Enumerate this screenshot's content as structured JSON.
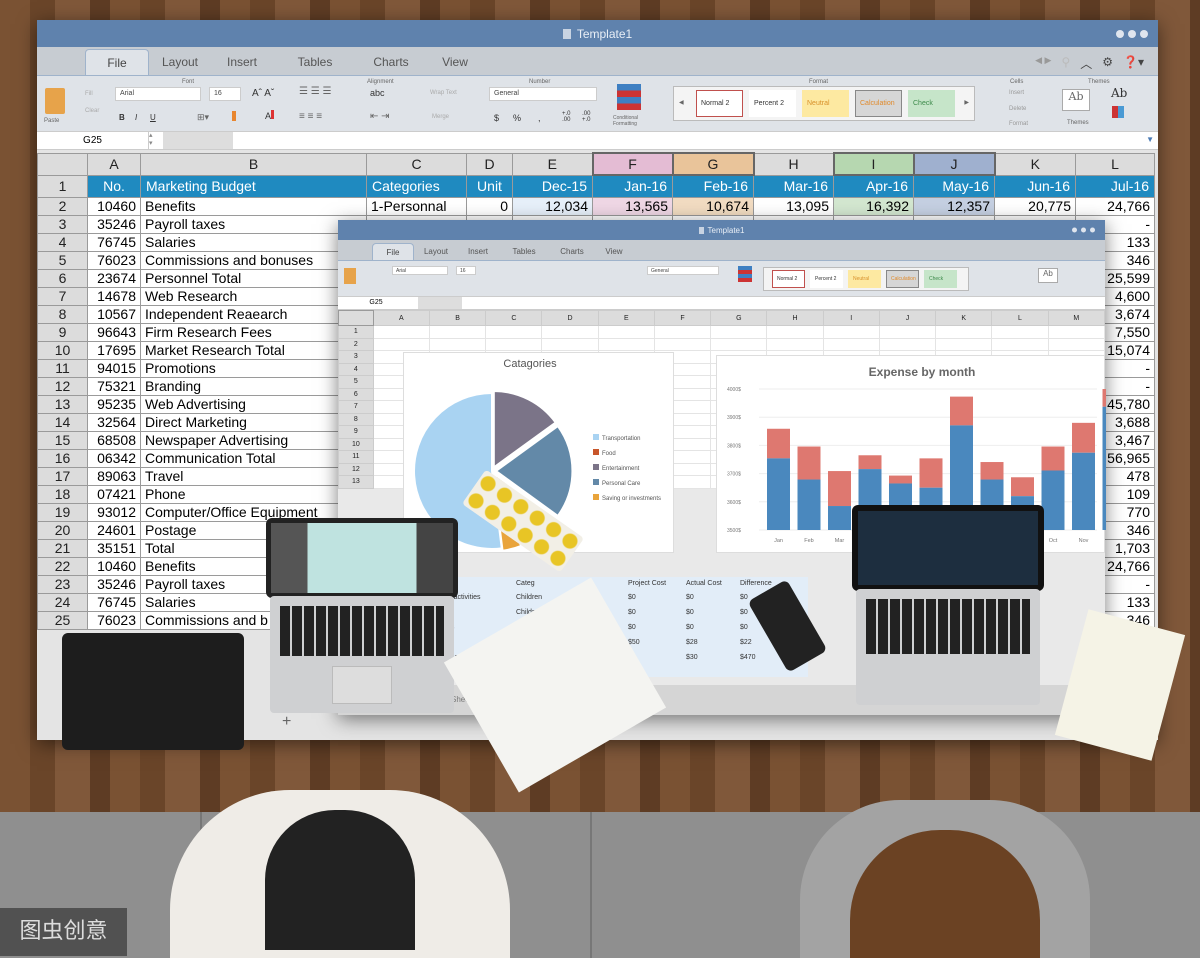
{
  "outer_window": {
    "title": "Template1",
    "tabs": [
      "File",
      "Layout",
      "Insert",
      "Tables",
      "Charts",
      "View"
    ],
    "active_tab": "File",
    "ribbon": {
      "paste": "Paste",
      "fill": "Fill",
      "clear": "Clear",
      "font_group": "Font",
      "font": "Arial",
      "size": "16",
      "bold": "B",
      "italic": "I",
      "underline": "U",
      "alignment_group": "Alignment",
      "abc": "abc",
      "wrap_text": "Wrap Text",
      "merge": "Merge",
      "number_group": "Number",
      "number_format": "General",
      "currency": "$",
      "percent": "%",
      "comma": ",",
      "inc_decimal": "+.0\n.00",
      "dec_decimal": ".00\n+.0",
      "conditional_formatting": "Conditional Formatting",
      "format_group": "Format",
      "styles": [
        {
          "label": "Normal 2",
          "bg": "#ffffff",
          "fg": "#333333",
          "border": "#c0504d"
        },
        {
          "label": "Percent 2",
          "bg": "#ffffff",
          "fg": "#333333",
          "border": "#ffffff"
        },
        {
          "label": "Neutral",
          "bg": "#fde9a1",
          "fg": "#d8902a",
          "border": "#fde9a1"
        },
        {
          "label": "Calculation",
          "bg": "#d6d6d6",
          "fg": "#e08a2c",
          "border": "#888888"
        },
        {
          "label": "Check",
          "bg": "#c6e5c9",
          "fg": "#3c8a4a",
          "border": "#c6e5c9"
        }
      ],
      "cells_group": "Cells",
      "insert": "Insert",
      "delete": "Delete",
      "format": "Format",
      "themes_group": "Themes",
      "themes": "Themes",
      "ab": "Ab"
    },
    "name_box": "G25",
    "columns": [
      "A",
      "B",
      "C",
      "D",
      "E",
      "F",
      "G",
      "H",
      "I",
      "J",
      "K",
      "L"
    ],
    "header_row": [
      "No.",
      "Marketing Budget",
      "Categories",
      "Unit",
      "Dec-15",
      "Jan-16",
      "Feb-16",
      "Mar-16",
      "Apr-16",
      "May-16",
      "Jun-16",
      "Jul-16"
    ],
    "highlight_columns": {
      "F": "#e4bcd4",
      "G": "#e9c49a",
      "I": "#b6d7b0",
      "J": "#9fb0cf"
    },
    "row2": [
      "10460",
      "Benefits",
      "1-Personnal",
      "0",
      "12,034",
      "13,565",
      "10,674",
      "13,095",
      "16,392",
      "12,357",
      "20,775",
      "24,766"
    ],
    "rows": [
      {
        "no": "35246",
        "name": "Payroll taxes",
        "jul": "-"
      },
      {
        "no": "76745",
        "name": "Salaries",
        "jul": "133"
      },
      {
        "no": "76023",
        "name": "Commissions and bonuses",
        "jul": "346"
      },
      {
        "no": "23674",
        "name": "Personnel Total",
        "jul": "25,599"
      },
      {
        "no": "14678",
        "name": "Web Research",
        "jul": "4,600"
      },
      {
        "no": "10567",
        "name": "Independent Reaearch",
        "jul": "3,674"
      },
      {
        "no": "96643",
        "name": "Firm Research Fees",
        "jul": "7,550"
      },
      {
        "no": "17695",
        "name": "Market Research Total",
        "jul": "15,074"
      },
      {
        "no": "94015",
        "name": "Promotions",
        "jul": "-"
      },
      {
        "no": "75321",
        "name": "Branding",
        "jul": "-"
      },
      {
        "no": "95235",
        "name": "Web Advertising",
        "jul": "45,780"
      },
      {
        "no": "32564",
        "name": "Direct Marketing",
        "jul": "3,688"
      },
      {
        "no": "68508",
        "name": "Newspaper Advertising",
        "jul": "3,467"
      },
      {
        "no": "06342",
        "name": "Communication Total",
        "jul": "56,965"
      },
      {
        "no": "89063",
        "name": "Travel",
        "jul": "478"
      },
      {
        "no": "07421",
        "name": "Phone",
        "jul": "109"
      },
      {
        "no": "93012",
        "name": "Computer/Office Equipment",
        "jul": "770"
      },
      {
        "no": "24601",
        "name": "Postage",
        "jul": "346"
      },
      {
        "no": "35151",
        "name": "Total",
        "jul": "1,703"
      },
      {
        "no": "10460",
        "name": "Benefits",
        "jul": "24,766"
      },
      {
        "no": "35246",
        "name": "Payroll taxes",
        "jul": "-"
      },
      {
        "no": "76745",
        "name": "Salaries",
        "jul": "133"
      },
      {
        "no": "76023",
        "name": "Commissions and b",
        "jul": "346"
      }
    ],
    "add_sheet": "+"
  },
  "inner_window": {
    "title": "Template1",
    "name_box": "G25",
    "columns": [
      "A",
      "B",
      "C",
      "D",
      "E",
      "F",
      "G",
      "H",
      "I",
      "J",
      "K",
      "L",
      "M"
    ],
    "sheet_tab": "Sheet",
    "table": {
      "headers": [
        "Categ",
        "Project Cost",
        "Actual Cost",
        "Difference"
      ],
      "rows": [
        [
          "ular activities",
          "Children",
          "$0",
          "$0",
          "$0"
        ],
        [
          "",
          "Childrer",
          "$0",
          "$0",
          "$0"
        ],
        [
          "plies",
          "Chil",
          "$0",
          "$0",
          "$0"
        ],
        [
          "",
          "",
          "$50",
          "$28",
          "$22"
        ],
        [
          "wnloads,etc.)",
          "",
          "",
          "$30",
          "$470"
        ]
      ]
    }
  },
  "chart_data": [
    {
      "type": "pie",
      "title": "Catagories",
      "legend": [
        "Transportation",
        "Food",
        "Entertainment",
        "Personal Care",
        "Saving or investments"
      ],
      "colors": [
        "#a9d3f2",
        "#c8562a",
        "#7b7488",
        "#6389a8",
        "#e9a43b"
      ],
      "values": [
        52,
        9,
        15,
        20,
        4
      ],
      "legend_position": "right"
    },
    {
      "type": "bar",
      "title": "Expense by month",
      "stacked": true,
      "categories": [
        "Jan",
        "Feb",
        "Mar",
        "Apr",
        "May",
        "Jun",
        "Jul",
        "Aug",
        "Sep",
        "Oct",
        "Nov",
        "Dec"
      ],
      "ylim": [
        3500,
        4000
      ],
      "yticks": [
        "3500$",
        "3600$",
        "3700$",
        "3800$",
        "3900$",
        "4000$"
      ],
      "series": [
        {
          "color": "#4a88be",
          "values": [
            3754,
            3679,
            3585,
            3716,
            3665,
            3650,
            3871,
            3679,
            3620,
            3711,
            3774,
            3937
          ]
        },
        {
          "color": "#de7870",
          "values": [
            3859,
            3796,
            3709,
            3765,
            3693,
            3754,
            3973,
            3741,
            3687,
            3796,
            3880,
            4000
          ]
        }
      ],
      "grid": true
    }
  ],
  "watermark": "图虫创意"
}
